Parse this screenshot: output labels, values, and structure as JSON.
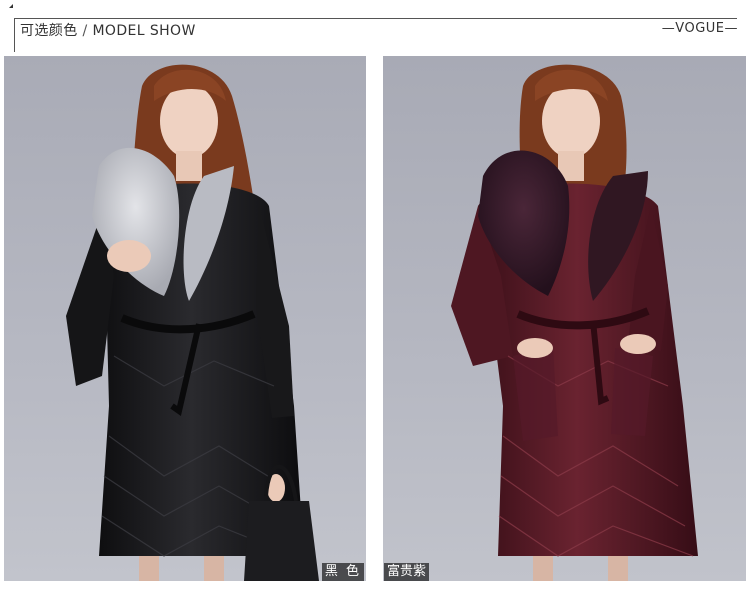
{
  "header": {
    "title_cn": "可选颜色",
    "separator": "/",
    "title_en": "MODEL SHOW",
    "vogue": "—VOGUE—"
  },
  "photos": [
    {
      "color_label": "黑 色",
      "coat_color": "#1b1b1d",
      "collar_color": "#c4c6cc"
    },
    {
      "color_label": "富贵紫",
      "coat_color": "#4a1620",
      "collar_color": "#3a1d2b"
    }
  ],
  "colors": {
    "background": "#b3b5bf",
    "text": "#333333"
  }
}
